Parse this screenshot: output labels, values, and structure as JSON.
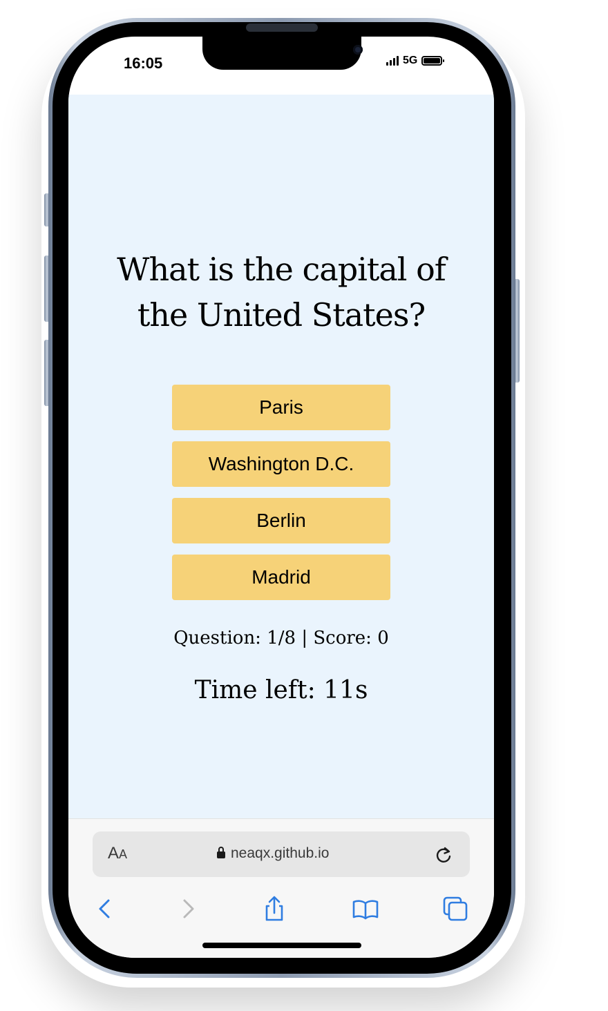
{
  "status_bar": {
    "time": "16:05",
    "network": "5G"
  },
  "quiz": {
    "question": "What is the capital of the United States?",
    "answers": [
      "Paris",
      "Washington D.C.",
      "Berlin",
      "Madrid"
    ],
    "progress": "Question: 1/8 | Score: 0",
    "timer": "Time left: 11s"
  },
  "browser": {
    "text_size_label_big": "A",
    "text_size_label_small": "A",
    "url": "neaqx.github.io",
    "icons": {
      "lock": "lock-icon",
      "reload": "reload-icon",
      "back": "back-icon",
      "forward": "forward-icon",
      "share": "share-icon",
      "bookmarks": "bookmarks-icon",
      "tabs": "tabs-icon"
    }
  },
  "colors": {
    "page_background": "#eaf4fd",
    "answer_button": "#f6d278",
    "browser_accent": "#2f7de1"
  }
}
